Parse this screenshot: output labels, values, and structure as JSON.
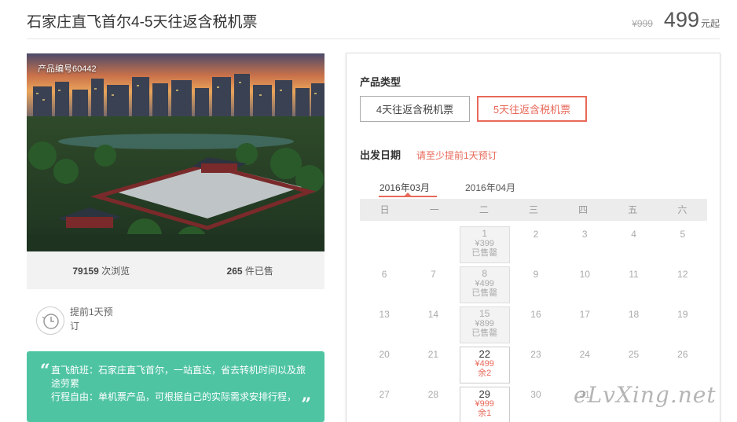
{
  "product": {
    "title": "石家庄直飞首尔4-5天往返含税机票",
    "original_price": "¥999",
    "price": "499",
    "price_suffix": "元起",
    "code_label": "产品编号60442",
    "views_count": "79159",
    "views_label": "次浏览",
    "sold_count": "265",
    "sold_label": "件已售"
  },
  "advance": {
    "text": "提前1天预订"
  },
  "note": {
    "open_quote": "“",
    "close_quote": "”",
    "line1": "直飞航班：石家庄直飞首尔，一站直达，省去转机时间以及旅途劳累",
    "line2": "行程自由：单机票产品，可根据自己的实际需求安排行程，"
  },
  "booking": {
    "type_label": "产品类型",
    "types": [
      "4天往返含税机票",
      "5天往返含税机票"
    ],
    "selected_type": "5天往返含税机票",
    "date_label": "出发日期",
    "date_hint": "请至少提前1天预订",
    "months": [
      "2016年03月",
      "2016年04月"
    ],
    "active_month": "2016年03月",
    "weekdays": [
      "日",
      "一",
      "二",
      "三",
      "四",
      "五",
      "六"
    ],
    "calendar": [
      [
        {
          "d": ""
        },
        {
          "d": ""
        },
        {
          "d": "1",
          "p": "¥399",
          "s": "已售罄"
        },
        {
          "d": "2"
        },
        {
          "d": "3"
        },
        {
          "d": "4"
        },
        {
          "d": "5"
        }
      ],
      [
        {
          "d": "6"
        },
        {
          "d": "7"
        },
        {
          "d": "8",
          "p": "¥499",
          "s": "已售罄"
        },
        {
          "d": "9"
        },
        {
          "d": "10"
        },
        {
          "d": "11"
        },
        {
          "d": "12"
        }
      ],
      [
        {
          "d": "13"
        },
        {
          "d": "14"
        },
        {
          "d": "15",
          "p": "¥899",
          "s": "已售罄"
        },
        {
          "d": "16"
        },
        {
          "d": "17"
        },
        {
          "d": "18"
        },
        {
          "d": "19"
        }
      ],
      [
        {
          "d": "20"
        },
        {
          "d": "21"
        },
        {
          "d": "22",
          "p": "¥499",
          "s": "余2",
          "avail": true
        },
        {
          "d": "23"
        },
        {
          "d": "24"
        },
        {
          "d": "25"
        },
        {
          "d": "26"
        }
      ],
      [
        {
          "d": "27"
        },
        {
          "d": "28"
        },
        {
          "d": "29",
          "p": "¥999",
          "s": "余1",
          "avail": true
        },
        {
          "d": "30"
        },
        {
          "d": "31"
        },
        {
          "d": ""
        },
        {
          "d": ""
        }
      ]
    ]
  },
  "watermark": "eLvXing.net",
  "icons": {
    "clock": "clock-icon"
  },
  "colors": {
    "accent": "#e8695a",
    "note_bg": "#4fc4a3"
  }
}
